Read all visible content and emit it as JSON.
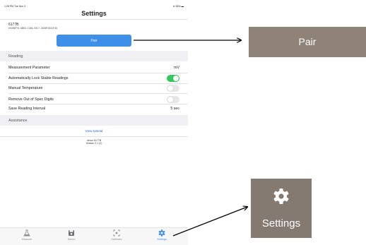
{
  "status_bar": {
    "left": "1:28 PM  Tue Nov 3",
    "right": "96%"
  },
  "header": {
    "title": "Settings"
  },
  "device": {
    "name": "6177B",
    "id": "D4269F74-9BD3-C349-03C7-3630F1031F38"
  },
  "pair_button": {
    "label": "Pair"
  },
  "reading": {
    "header": "Reading",
    "rows": [
      {
        "label": "Measurement Parameter",
        "value": "mV"
      },
      {
        "label": "Automatically Lock Stable Readings",
        "toggle": true
      },
      {
        "label": "Manual Temperature",
        "toggle": false
      },
      {
        "label": "Remove Out of Spec Digits",
        "toggle": false
      },
      {
        "label": "Save Reading Interval",
        "value": "5 sec"
      }
    ]
  },
  "assistance": {
    "header": "Assistance",
    "tutorial_link": "View tutorial",
    "app_name": "Jenco 6177B",
    "version": "Version 2.1 (2)"
  },
  "tabs": [
    {
      "label": "Measure",
      "icon": "flask-icon"
    },
    {
      "label": "Saved",
      "icon": "save-icon"
    },
    {
      "label": "Calibrate",
      "icon": "calibrate-icon"
    },
    {
      "label": "Settings",
      "icon": "gear-icon",
      "active": true
    }
  ],
  "callouts": {
    "pair_text": "Pair",
    "settings_text": "Settings"
  },
  "colors": {
    "accent": "#3d8fe8",
    "toggle_on": "#34c759",
    "callout_bg": "#8f8378"
  }
}
